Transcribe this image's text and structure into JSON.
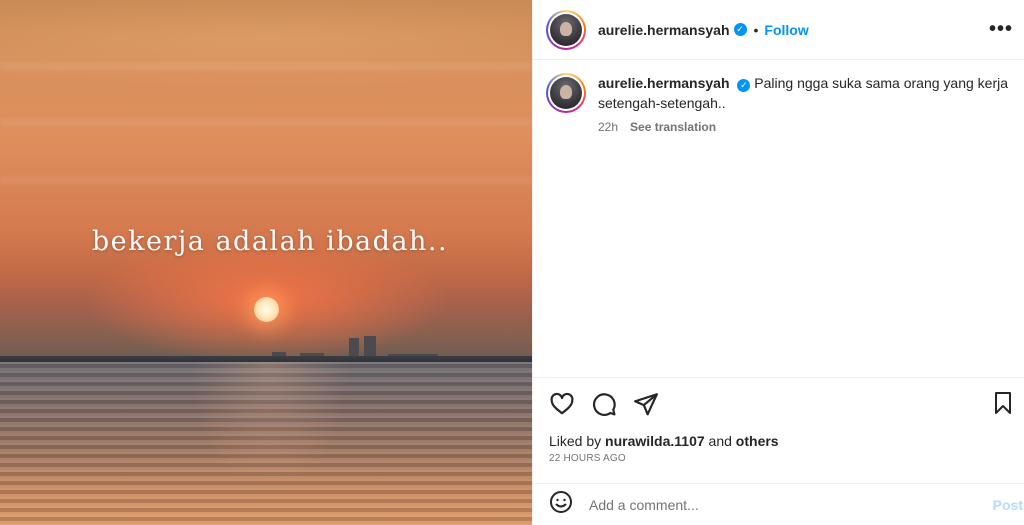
{
  "media": {
    "overlay_text": "bekerja adalah ibadah.."
  },
  "header": {
    "username": "aurelie.hermansyah",
    "separator": "•",
    "follow_label": "Follow",
    "more_label": "•••"
  },
  "caption": {
    "username": "aurelie.hermansyah",
    "text": "Paling ngga suka sama orang yang kerja setengah-setengah..",
    "time": "22h",
    "see_translation": "See translation"
  },
  "likes": {
    "prefix": "Liked by",
    "user": "nurawilda.1107",
    "and": "and",
    "others": "others"
  },
  "timestamp": "22 HOURS AGO",
  "comment": {
    "placeholder": "Add a comment...",
    "post_label": "Post"
  },
  "icons": {
    "verified": "verified-badge-icon",
    "like": "heart-icon",
    "comment": "comment-icon",
    "share": "share-icon",
    "save": "bookmark-icon",
    "emoji": "emoji-icon"
  },
  "colors": {
    "accent": "#0095f6",
    "text": "#262626",
    "muted": "#737373"
  }
}
